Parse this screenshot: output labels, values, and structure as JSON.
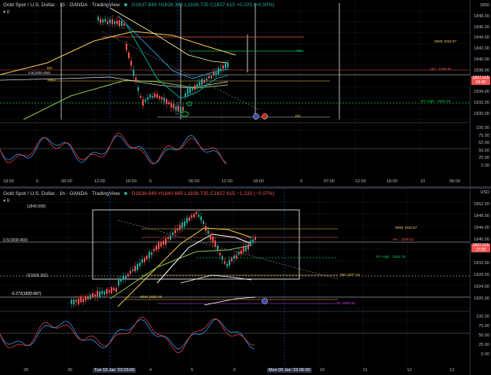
{
  "top": {
    "header": {
      "title": "Gold Spot / U.S. Dollar · 15 · OANDA · TradingView",
      "ohlc": "O1837.849 H1838.385 L1836.735 C1837.615 +0.020 (+0.00%)"
    },
    "collapse": "▾ 8",
    "price_axis": [
      "1850",
      "1848.00",
      "1846.00",
      "1844.00",
      "1842.00",
      "1840.00",
      "1838.00",
      "1836.00",
      "1834.00",
      "1832.00",
      "1830.00"
    ],
    "price_box": {
      "price": "1837.615",
      "time": "03:40"
    },
    "osc_axis": [
      "100.00",
      "75.00",
      "62.00",
      "50.00",
      "25.00",
      "0.00"
    ],
    "time_axis": [
      "18:00",
      "5",
      "06:00",
      "12:00",
      "18:00",
      "6",
      "06:00",
      "12:00",
      "18:00",
      "9",
      "07:00",
      "12:00",
      "18:00",
      "10",
      "06:00"
    ],
    "labels": {
      "wm": "WM4 1842.67",
      "yh": "YHi",
      "hh": "HH · 1839.51",
      "fib05": "0.5(1838.469)",
      "dd": "DD",
      "ywo": "YWO",
      "dyh": "DY High · 1833.79",
      "dd2": "DD"
    }
  },
  "bottom": {
    "header": {
      "title": "Gold Spot / U.S. Dollar · 1h · OANDA · TradingView",
      "ohlc": "O1838.849 H1840.685 L1836.735 C1837.615 −1.233 (−0.07%)"
    },
    "collapse": "▾ 9",
    "price_axis": [
      "USD",
      "1852.00",
      "1848.00",
      "1844.00",
      "1840.00",
      "1836.00",
      "1832.00",
      "1828.00",
      "1824.00",
      "1820.00"
    ],
    "price_box": {
      "price": "1837.615",
      "time": "17:00"
    },
    "osc_axis": [
      "100.00",
      "75.00",
      "50.00",
      "25.00",
      "0.00"
    ],
    "time_axis": [
      "29",
      "30",
      "4",
      "5",
      "6",
      "10",
      "11",
      "12",
      "13"
    ],
    "time_selected": [
      "Tue 03 Jan '23  03:00",
      "Mon 09 Jan '23  06:00"
    ],
    "labels": {
      "fib1": "1(849.999)",
      "wm": "WM4 1843.67",
      "hh": "HH · 1839.51",
      "fib05": "0.5(1838.469)",
      "dyh": "DY High · 1833.79",
      "fib0": "0(1828.302)",
      "wd": "WD 1827.34",
      "fib0272": "-0.272(1820.687)",
      "wm2": "WM4 1820.48",
      "y": "YL 1816.34"
    }
  }
}
